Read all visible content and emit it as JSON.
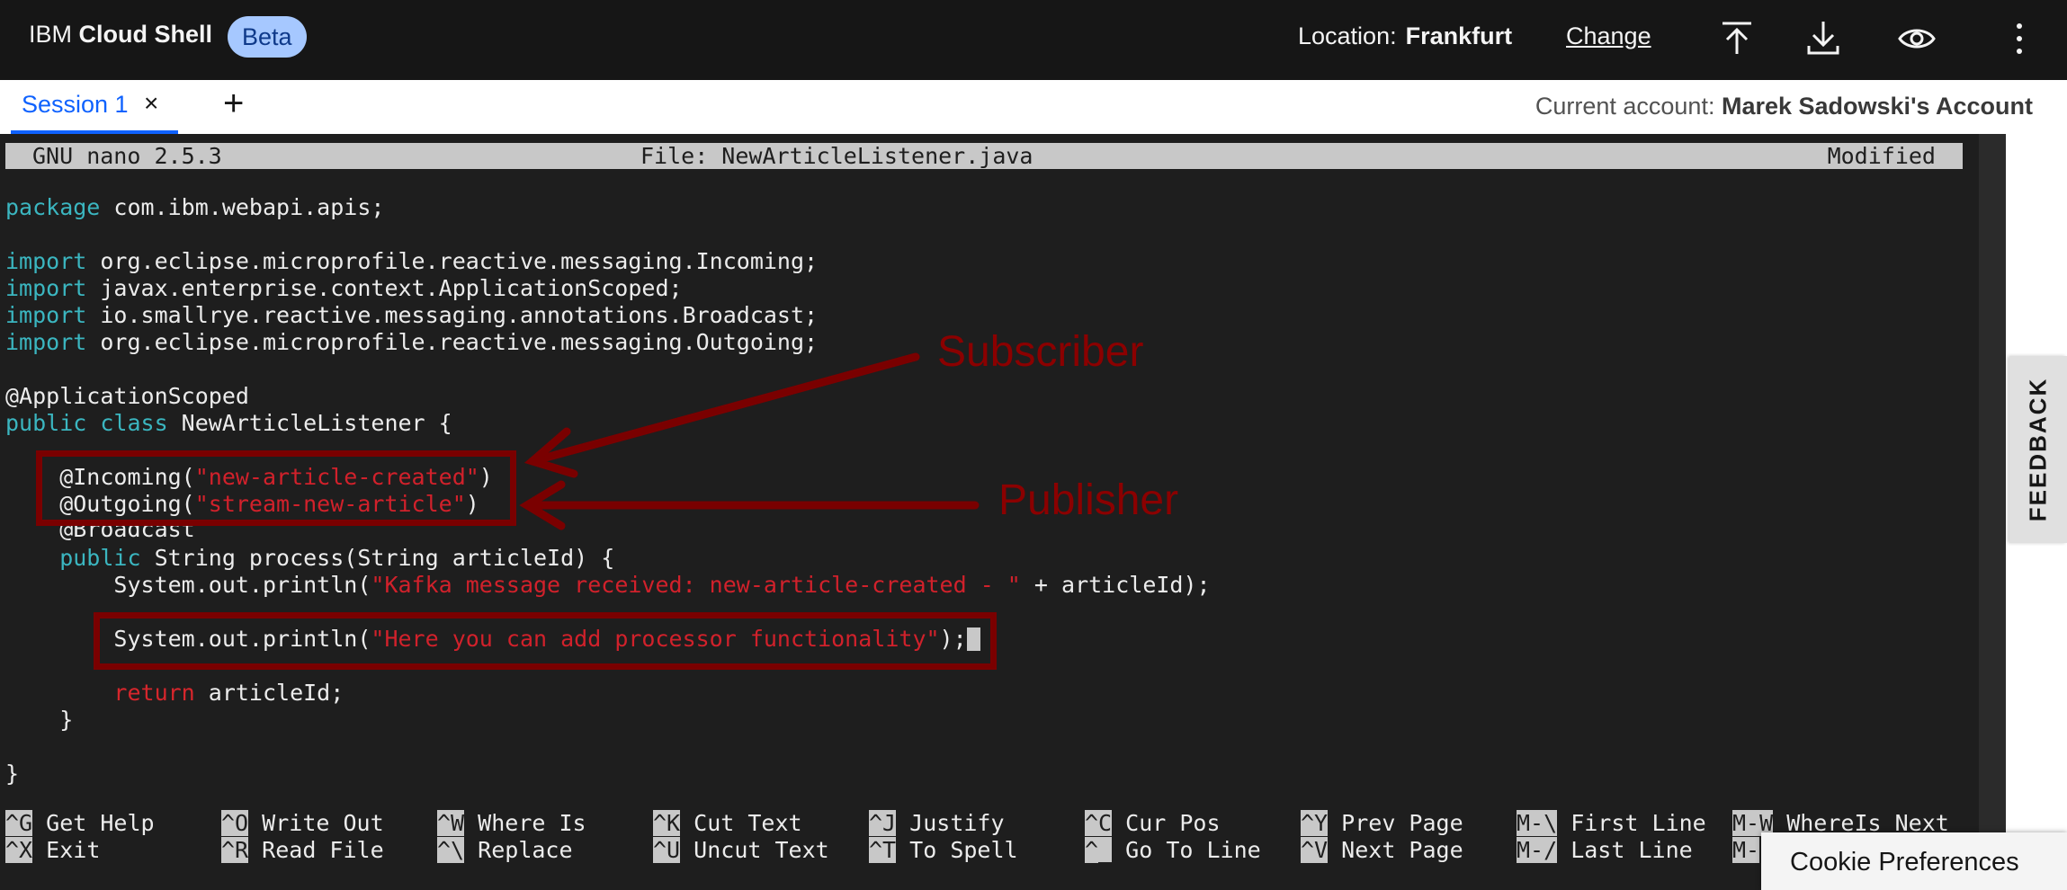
{
  "header": {
    "brand_prefix": "IBM",
    "brand_name": "Cloud Shell",
    "badge": "Beta",
    "location_label": "Location:",
    "location_value": "Frankfurt",
    "change_link": "Change",
    "icons": [
      "upload-icon",
      "download-icon",
      "view-icon",
      "overflow-menu-icon"
    ]
  },
  "tabs": {
    "session_label": "Session 1",
    "close_glyph": "×",
    "add_glyph": "+",
    "account_label": "Current account:",
    "account_value": "Marek Sadowski's Account"
  },
  "nano": {
    "version": "GNU nano 2.5.3",
    "file": "File: NewArticleListener.java",
    "status": "Modified"
  },
  "code": {
    "l1_kw": "package",
    "l1_rest": " com.ibm.webapi.apis;",
    "l2_kw": "import",
    "l2_rest": " org.eclipse.microprofile.reactive.messaging.Incoming;",
    "l3_kw": "import",
    "l3_rest": " javax.enterprise.context.ApplicationScoped;",
    "l4_kw": "import",
    "l4_rest": " io.smallrye.reactive.messaging.annotations.Broadcast;",
    "l5_kw": "import",
    "l5_rest": " org.eclipse.microprofile.reactive.messaging.Outgoing;",
    "l6": "@ApplicationScoped",
    "l7_kw1": "public",
    "l7_kw2": " class",
    "l7_rest": " NewArticleListener {",
    "l8_a": "    @Incoming(",
    "l8_s": "\"new-article-created\"",
    "l8_b": ")",
    "l9_a": "    @Outgoing(",
    "l9_s": "\"stream-new-article\"",
    "l9_b": ")",
    "l10": "    @Broadcast",
    "l11_kw": "    public",
    "l11_rest": " String process(String articleId) {",
    "l12_a": "        System.out.println(",
    "l12_s": "\"Kafka message received: new-article-created - \"",
    "l12_b": " + articleId);",
    "l13_a": "        System.out.println(",
    "l13_s": "\"Here you can add processor functionality\"",
    "l13_b": ");",
    "l14_kw": "        return",
    "l14_rest": " articleId;",
    "l15": "    }",
    "l16": "}"
  },
  "annotations": {
    "subscriber": "Subscriber",
    "publisher": "Publisher"
  },
  "shortcuts": [
    {
      "key": "^G",
      "label": " Get Help"
    },
    {
      "key": "^O",
      "label": " Write Out"
    },
    {
      "key": "^W",
      "label": " Where Is"
    },
    {
      "key": "^K",
      "label": " Cut Text"
    },
    {
      "key": "^J",
      "label": " Justify"
    },
    {
      "key": "^C",
      "label": " Cur Pos"
    },
    {
      "key": "^Y",
      "label": " Prev Page"
    },
    {
      "key": "M-\\",
      "label": " First Line"
    },
    {
      "key": "M-W",
      "label": " WhereIs Next"
    },
    {
      "key": "^X",
      "label": " Exit"
    },
    {
      "key": "^R",
      "label": " Read File"
    },
    {
      "key": "^\\",
      "label": " Replace"
    },
    {
      "key": "^U",
      "label": " Uncut Text"
    },
    {
      "key": "^T",
      "label": " To Spell"
    },
    {
      "key": "^_",
      "label": " Go To Line"
    },
    {
      "key": "^V",
      "label": " Next Page"
    },
    {
      "key": "M-/",
      "label": " Last Line"
    },
    {
      "key": "M-",
      "label": ""
    }
  ],
  "feedback": "FEEDBACK",
  "cookie": "Cookie Preferences",
  "colors": {
    "topbar": "#161616",
    "badge_bg": "#a6c8ff",
    "tab_accent": "#0f62fe",
    "keyword": "#3bb6c0",
    "string": "#d1212b",
    "annotation": "#8b0000"
  }
}
